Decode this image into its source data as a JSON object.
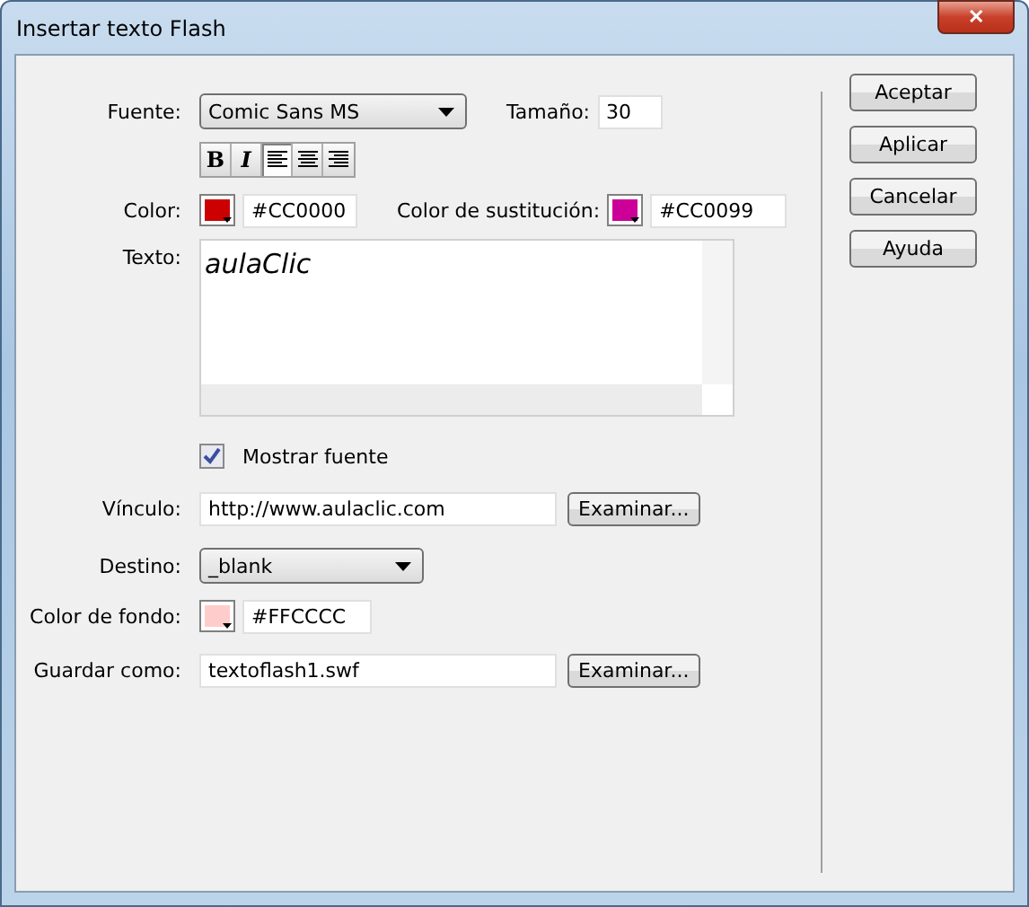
{
  "window": {
    "title": "Insertar texto Flash",
    "close_label": "✕"
  },
  "font": {
    "label": "Fuente:",
    "value": "Comic Sans MS"
  },
  "size": {
    "label": "Tamaño:",
    "value": "30"
  },
  "format_buttons": [
    {
      "kind": "bold",
      "label": "B",
      "pressed": false
    },
    {
      "kind": "italic",
      "label": "I",
      "pressed": false
    },
    {
      "kind": "align-left",
      "pressed": true
    },
    {
      "kind": "align-center",
      "pressed": false
    },
    {
      "kind": "align-right",
      "pressed": false
    }
  ],
  "color": {
    "label": "Color:",
    "color": "#cc0000",
    "value": "#CC0000"
  },
  "rollover_color": {
    "label": "Color de sustitución:",
    "color": "#cc0099",
    "value": "#CC0099"
  },
  "text": {
    "label": "Texto:",
    "value": "aulaClic"
  },
  "show_font": {
    "label": "Mostrar fuente",
    "checked": true
  },
  "link": {
    "label": "Vínculo:",
    "value": "http://www.aulaclic.com",
    "button": "Examinar..."
  },
  "target": {
    "label": "Destino:",
    "value": "_blank"
  },
  "background": {
    "label": "Color de fondo:",
    "color": "#ffcccc",
    "value": "#FFCCCC"
  },
  "save_as": {
    "label": "Guardar como:",
    "value": "textoflash1.swf",
    "button": "Examinar..."
  },
  "buttons": [
    "Aceptar",
    "Aplicar",
    "Cancelar",
    "Ayuda"
  ]
}
